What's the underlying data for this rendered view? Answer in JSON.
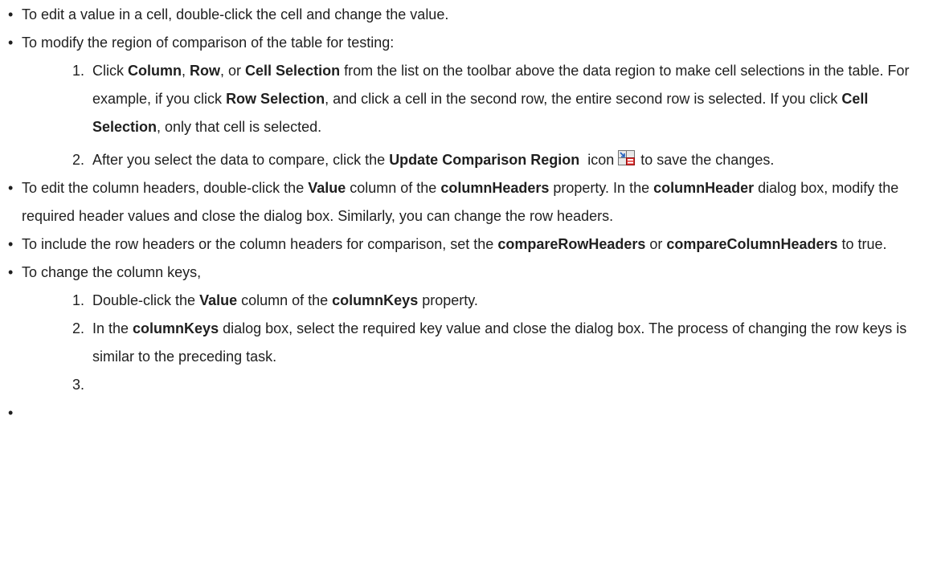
{
  "items": [
    {
      "parts": [
        "To edit a value in a cell, double-click the cell and change the value."
      ]
    },
    {
      "intro": "To modify the region of comparison of the table for testing:",
      "steps": [
        {
          "num": "1.",
          "t1": "Click ",
          "b1": "Column",
          "t2": ", ",
          "b2": "Row",
          "t3": ", or ",
          "b3": "Cell Selection",
          "t4": " from the list on the toolbar above the data region to make cell selections in the table. For example, if you click ",
          "b4": "Row Selection",
          "t5": ", and click a cell in the second row, the entire second row is selected. If you click ",
          "b5": "Cell Selection",
          "t6": ", only that cell is selected."
        },
        {
          "num": "2.",
          "t1": "After you select the data to compare, click the ",
          "b1": "Update Comparison Region",
          "t2": "  icon ",
          "icon": "update-comparison-region-icon",
          "t3": " to save the changes."
        }
      ]
    },
    {
      "t1": "To edit the column headers, double-click the ",
      "b1": "Value",
      "t2": " column of the ",
      "b2": "columnHeaders",
      "t3": " property. In the ",
      "b3": "columnHeader",
      "t4": " dialog box, modify the required header values and close the dialog box. Similarly, you can change the row headers."
    },
    {
      "t1": "To include the row headers or the column headers for comparison, set the ",
      "b1": "compareRowHeaders",
      "t2": " or ",
      "b2": "compareColumnHeaders",
      "t3": " to true."
    },
    {
      "intro": "To change the column keys,",
      "steps": [
        {
          "num": "1.",
          "t1": "Double-click the ",
          "b1": "Value",
          "t2": " column of the ",
          "b2": "columnKeys",
          "t3": " property."
        },
        {
          "num": "2.",
          "t1": "In the ",
          "b1": "columnKeys",
          "t2": " dialog box, select the required key value and close the dialog box. The process of changing the row keys is similar to the preceding task."
        },
        {
          "num": "3."
        }
      ]
    }
  ]
}
